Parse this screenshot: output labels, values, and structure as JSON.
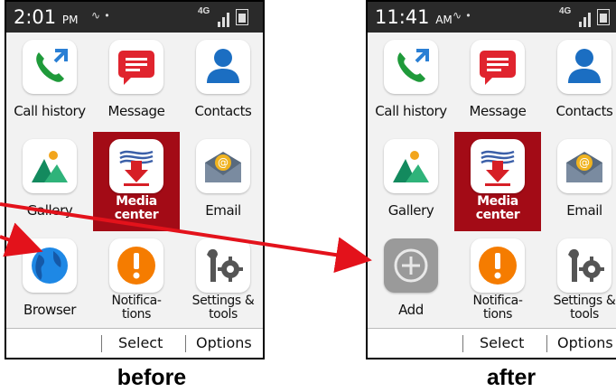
{
  "before": {
    "time": "2:01",
    "ampm": "PM",
    "caption": "before",
    "apps": [
      {
        "label": "Call history",
        "icon": "call-history-icon"
      },
      {
        "label": "Message",
        "icon": "message-icon"
      },
      {
        "label": "Contacts",
        "icon": "contacts-icon"
      },
      {
        "label": "Gallery",
        "icon": "gallery-icon"
      },
      {
        "label": "Media center",
        "icon": "media-center-icon",
        "selected": true
      },
      {
        "label": "Email",
        "icon": "email-icon"
      },
      {
        "label": "Browser",
        "icon": "browser-icon"
      },
      {
        "label": "Notifica-tions",
        "icon": "notifications-icon"
      },
      {
        "label": "Settings & tools",
        "icon": "settings-tools-icon"
      }
    ]
  },
  "after": {
    "time": "11:41",
    "ampm": "AM",
    "caption": "after",
    "apps": [
      {
        "label": "Call history",
        "icon": "call-history-icon"
      },
      {
        "label": "Message",
        "icon": "message-icon"
      },
      {
        "label": "Contacts",
        "icon": "contacts-icon"
      },
      {
        "label": "Gallery",
        "icon": "gallery-icon"
      },
      {
        "label": "Media center",
        "icon": "media-center-icon",
        "selected": true
      },
      {
        "label": "Email",
        "icon": "email-icon"
      },
      {
        "label": "Add",
        "icon": "add-icon"
      },
      {
        "label": "Notifica-tions",
        "icon": "notifications-icon"
      },
      {
        "label": "Settings & tools",
        "icon": "settings-tools-icon"
      }
    ]
  },
  "softkeys": {
    "center": "Select",
    "right": "Options"
  },
  "status": {
    "network": "4G"
  },
  "colors": {
    "selected_tile": "#a30b16",
    "arrow": "#e3121b",
    "status_bar": "#2a2a2a"
  }
}
